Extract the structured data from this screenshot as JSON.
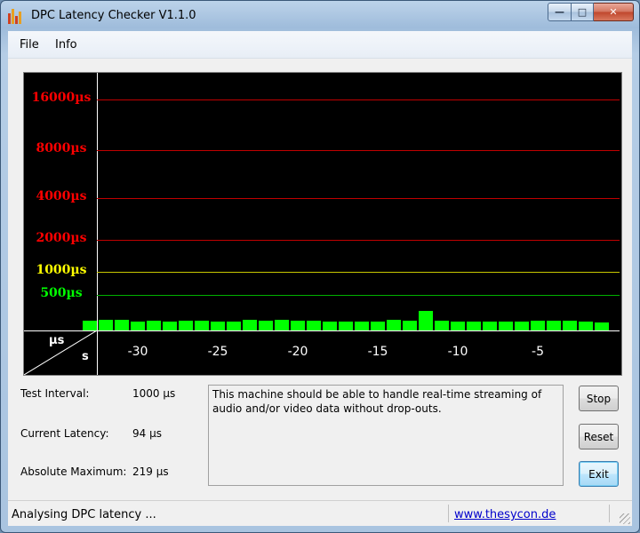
{
  "window": {
    "title": "DPC Latency Checker V1.1.0"
  },
  "menu": {
    "file": "File",
    "info": "Info"
  },
  "graph": {
    "y_labels": [
      {
        "text": "16000µs",
        "color": "#ff0000"
      },
      {
        "text": "8000µs",
        "color": "#ff0000"
      },
      {
        "text": "4000µs",
        "color": "#ff0000"
      },
      {
        "text": "2000µs",
        "color": "#ff0000"
      },
      {
        "text": "1000µs",
        "color": "#ffff00"
      },
      {
        "text": "500µs",
        "color": "#00ff00"
      }
    ],
    "unit_y": "µs",
    "unit_x": "s",
    "x_labels": [
      "-30",
      "-25",
      "-20",
      "-15",
      "-10",
      "-5"
    ],
    "bar_color": "#00ff00"
  },
  "chart_data": {
    "type": "bar",
    "x": [
      -33,
      -32,
      -31,
      -30,
      -29,
      -28,
      -27,
      -26,
      -25,
      -24,
      -23,
      -22,
      -21,
      -20,
      -19,
      -18,
      -17,
      -16,
      -15,
      -14,
      -13,
      -12,
      -11,
      -10,
      -9,
      -8,
      -7,
      -6,
      -5,
      -4,
      -3,
      -2,
      -1
    ],
    "values": [
      110,
      118,
      118,
      100,
      110,
      100,
      110,
      110,
      100,
      100,
      118,
      110,
      118,
      110,
      110,
      100,
      100,
      100,
      100,
      118,
      110,
      219,
      110,
      100,
      100,
      100,
      100,
      100,
      110,
      110,
      110,
      100,
      94
    ],
    "ylabel": "µs",
    "xlabel": "s",
    "y_scale": "log2",
    "y_ticks": [
      500,
      1000,
      2000,
      4000,
      8000,
      16000
    ]
  },
  "info": {
    "test_interval_label": "Test Interval:",
    "test_interval_value": "1000 µs",
    "current_latency_label": "Current Latency:",
    "current_latency_value": "94 µs",
    "absolute_max_label": "Absolute Maximum:",
    "absolute_max_value": "219 µs"
  },
  "message": "This machine should be able to handle real-time streaming of audio and/or video data without drop-outs.",
  "buttons": {
    "stop": "Stop",
    "reset": "Reset",
    "exit": "Exit"
  },
  "status": {
    "text": "Analysing DPC latency ...",
    "link": "www.thesycon.de"
  },
  "caption": {
    "min": "—",
    "max": "□",
    "close": "✕"
  }
}
